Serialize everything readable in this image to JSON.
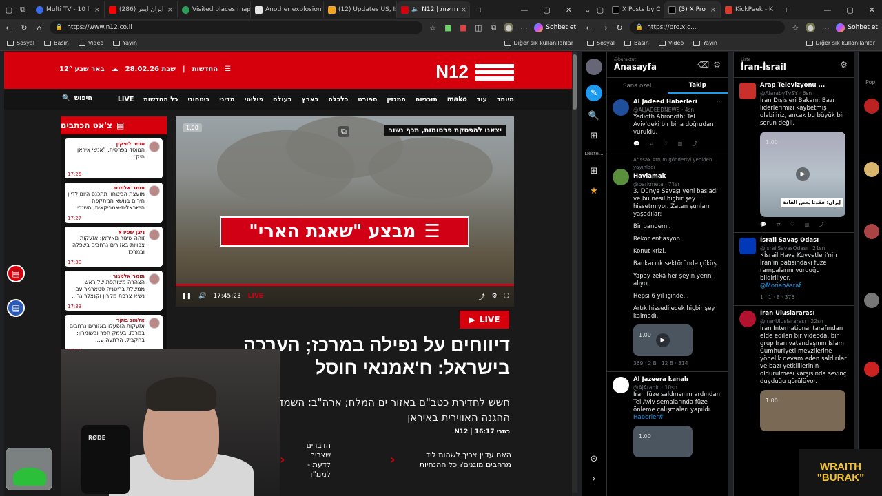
{
  "left_browser": {
    "tabs": [
      {
        "label": "Multi TV - 10 li",
        "color": "#3b6df0"
      },
      {
        "label": "(286) ایران اینتر",
        "color": "#ff0000"
      },
      {
        "label": "Visited places map",
        "color": "#2e9e5b"
      },
      {
        "label": "Another explosion",
        "color": "#e8e8e8"
      },
      {
        "label": "(12) Updates US, Isr",
        "color": "#f5a623"
      },
      {
        "label": "N12 | חדשות",
        "color": "#d6000c"
      }
    ],
    "url": "https://www.n12.co.il",
    "profile_button": "Sohbet et",
    "bookmarks": [
      "Sosyal",
      "Basın",
      "Video",
      "Yayın"
    ],
    "other_bookmarks": "Diğer sık kullanılanlar"
  },
  "n12": {
    "logo": "N12",
    "date": "שבת 28.02.26",
    "section_label": "החדשות",
    "weather": "באר שבע 12°",
    "nav": [
      "LIVE",
      "כל החדשות",
      "ביטחוני",
      "מדיני",
      "פוליטי",
      "בעולם",
      "בארץ",
      "כלכלה",
      "ספורט",
      "המגזין",
      "תוכניות",
      "mako",
      "עוד",
      "מיוחד"
    ],
    "search": "חיפוש",
    "chat_title": "צ'אט הכתבים",
    "chat_messages": [
      {
        "author": "ספיר ליפקין",
        "text": "המוסד בפרסית: \"אנשי איראן היק׳...",
        "time": "17:25"
      },
      {
        "author": "תומר אלמגור",
        "text": "מועצת הביטחון תתכנס היום לדיון חירום בנושא המתקפה הישראלית-אמריקאית; השגרי...",
        "time": "17:27"
      },
      {
        "author": "ניצן שפירא",
        "text": "זוהה שיגור מאיראן: אזעקות צפויות באזורים נרחבים בשפלה ובמרכז",
        "time": "17:30"
      },
      {
        "author": "תומר אלמגור",
        "text": "הצהרה משותפת של ראש ממשלת בריטניה סטארמר עם נשיא צרפת מקרון וקנצלר גר...",
        "time": "17:33"
      },
      {
        "author": "אלמוג בוקר",
        "text": "אזעקות הופעלו באזורים נרחבים במרכז, בעמק חפר ובשומרון; בחקביל, הרתעה ע...",
        "time": "17:36"
      }
    ],
    "video": {
      "top_caption": "יצאנו להפסקת פרסומות, תכף נשוב",
      "banner": "מבצע \"שאגת הארי\"",
      "badge": "1.00",
      "time": "17:45:23",
      "live_tag": "LIVE"
    },
    "live_label": "LIVE",
    "headline_1": "דיווחים על נפילה במרכז; הערכה",
    "headline_2": "בישראל: ח'אמנאי חוסל",
    "sub_1": "חשש לחדירת כטב\"ם באזור ים המלח; ארה\"ב: השמדנו את",
    "sub_2": "ההגנה האווירית באיראן",
    "byline": "כתבי N12 | 16:17",
    "related_1": "האם עדיין צריך לשהות ליד מרחבים מוגנים? כל ההנחיות",
    "related_2": "הדברים שצריך לדעת - לממ\"ד"
  },
  "webcam": {
    "mic_brand": "RØDE"
  },
  "right_browser": {
    "tabs": [
      {
        "label": "X Posts by C",
        "color": "#000000"
      },
      {
        "label": "(3) X Pro",
        "color": "#000000"
      },
      {
        "label": "KickPeek - K",
        "color": "#d93a2b"
      }
    ],
    "url": "https://pro.x.c...",
    "profile_button": "Sohbet et",
    "bookmarks": [
      "Sosyal",
      "Basın",
      "Video",
      "Yayın"
    ],
    "other_bookmarks": "Diğer sık kullanılanlar"
  },
  "x": {
    "sidebar_label": "Deste...",
    "col1": {
      "handle": "@buraktut",
      "title": "Anasayfa",
      "tabs": [
        "Sana özel",
        "Takip"
      ],
      "tweets": [
        {
          "name": "Al Jadeed Haberleri",
          "handle": "@ALJADEEDNEWS · 4sn",
          "text": "Yedioth Ahronoth: Tel Aviv'deki bir bina doğrudan vuruldu.",
          "color": "#1f4e9a"
        },
        {
          "retweet": "Arissax Atrum gönderiyi yeniden yayınladı",
          "name": "Havlamak",
          "handle": "@barkmeta · 7'ler",
          "text": "3. Dünya Savaşı yeni başladı ve bu nesil hiçbir şey hissetmiyor. Zaten şunları yaşadılar:",
          "list": [
            "Bir pandemi.",
            "Rekor enflasyon.",
            "Konut krizi.",
            "Bankacılık sektöründe çöküş.",
            "Yapay zekâ her şeyin yerini alıyor.",
            "Hepsi 6 yıl içinde...",
            "Artık hissedilecek hiçbir şey kalmadı."
          ],
          "media_badge": "1.00",
          "stats": "369 · 2 B · 12 B · 314",
          "color": "#5a8f3e"
        },
        {
          "name": "Al Jazeera kanalı",
          "handle": "@AJArabic · 10sn",
          "text": "İran füze saldırısının ardından Tel Aviv semalarında füze önleme çalışmaları yapıldı.",
          "tag": "Haberler#",
          "media_badge": "1.00",
          "color": "#ffffff"
        }
      ]
    },
    "col2": {
      "subtitle": "Liste",
      "title": "İran-İsrail",
      "tweets": [
        {
          "name": "Arap Televizyonu ...",
          "handle": "@AlarabyTvSY · 6sn",
          "text": "İran Dışişleri Bakanı: Bazı liderlerimizi kaybetmiş olabiliriz, ancak bu büyük bir sorun değil.",
          "media_badge": "1.00",
          "media_caption": "إيران: فقدنا بعض القادة",
          "color": "#c9302c"
        },
        {
          "name": "İsrail Savaş Odası",
          "handle": "@IsrailSavaşOdası · 21sn",
          "text": "⚡İsrail Hava Kuvvetleri'nin İran'ın batısındaki füze rampalarını vurduğu bildiriliyor.",
          "mention": "@MoriahAsraf",
          "stats": "1 · 1 · 8 · 376",
          "color": "#0038b8"
        },
        {
          "name": "İran Uluslararası",
          "handle": "@IranUluslararası · 22sn",
          "text": "İran International tarafından elde edilen bir videoda, bir grup İran vatandaşının İslam Cumhuriyeti mevzilerine yönelik devam eden saldırılar ve bazı yetkililerinin öldürülmesi karşısında sevinç duyduğu görülüyor.",
          "media_badge": "1.00",
          "color": "#b3122e"
        }
      ]
    },
    "col3_label": "Popi"
  },
  "overlay": {
    "line1": "WRAITH",
    "line2": "\"BURAK\""
  }
}
